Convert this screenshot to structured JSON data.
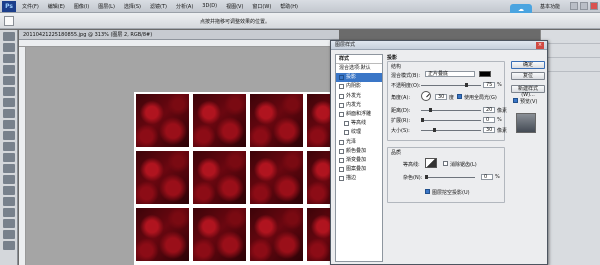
{
  "app": {
    "logo": "Ps",
    "menu": [
      "文件(F)",
      "编辑(E)",
      "图像(I)",
      "图层(L)",
      "选择(S)",
      "滤镜(T)",
      "分析(A)",
      "3D(D)",
      "视图(V)",
      "窗口(W)",
      "帮助(H)"
    ],
    "workspace": "基本功能"
  },
  "options_bar": {
    "hint": "点按并拖移可调整效果的位置。"
  },
  "document": {
    "tab_title": "20110421225180855.jpg @ 313% (图层 2, RGB/8#)"
  },
  "right_panel": {
    "rows": [
      "",
      "",
      ""
    ]
  },
  "dialog": {
    "title": "图层样式",
    "close": "×",
    "styles_header": "样式",
    "blend_options": "混合选项:默认",
    "styles": [
      {
        "label": "投影",
        "checked": true,
        "selected": true
      },
      {
        "label": "内阴影",
        "checked": false
      },
      {
        "label": "外发光",
        "checked": false
      },
      {
        "label": "内发光",
        "checked": false
      },
      {
        "label": "斜面和浮雕",
        "checked": false
      },
      {
        "label": "等高线",
        "checked": false,
        "indent": true
      },
      {
        "label": "纹理",
        "checked": false,
        "indent": true
      },
      {
        "label": "光泽",
        "checked": false
      },
      {
        "label": "颜色叠加",
        "checked": false
      },
      {
        "label": "渐变叠加",
        "checked": false
      },
      {
        "label": "图案叠加",
        "checked": false
      },
      {
        "label": "描边",
        "checked": false
      }
    ],
    "section_title": "投影",
    "structure_title": "结构",
    "blend_mode_label": "混合模式(B):",
    "blend_mode_value": "正片叠底",
    "opacity_label": "不透明度(O):",
    "opacity_value": "75",
    "opacity_unit": "%",
    "angle_label": "角度(A):",
    "angle_value": "30",
    "angle_unit": "度",
    "global_light_label": "使用全局光(G)",
    "distance_label": "距离(D):",
    "distance_value": "20",
    "distance_unit": "像素",
    "spread_label": "扩展(R):",
    "spread_value": "0",
    "spread_unit": "%",
    "size_label": "大小(S):",
    "size_value": "30",
    "size_unit": "像素",
    "quality_title": "品质",
    "contour_label": "等高线:",
    "antialias_label": "消除锯齿(L)",
    "noise_label": "杂色(N):",
    "noise_value": "0",
    "noise_unit": "%",
    "knockout_label": "图层挖空投影(U)",
    "buttons": {
      "ok": "确定",
      "reset": "复位",
      "new_style": "新建样式(W)...",
      "preview": "预览(V)"
    }
  }
}
